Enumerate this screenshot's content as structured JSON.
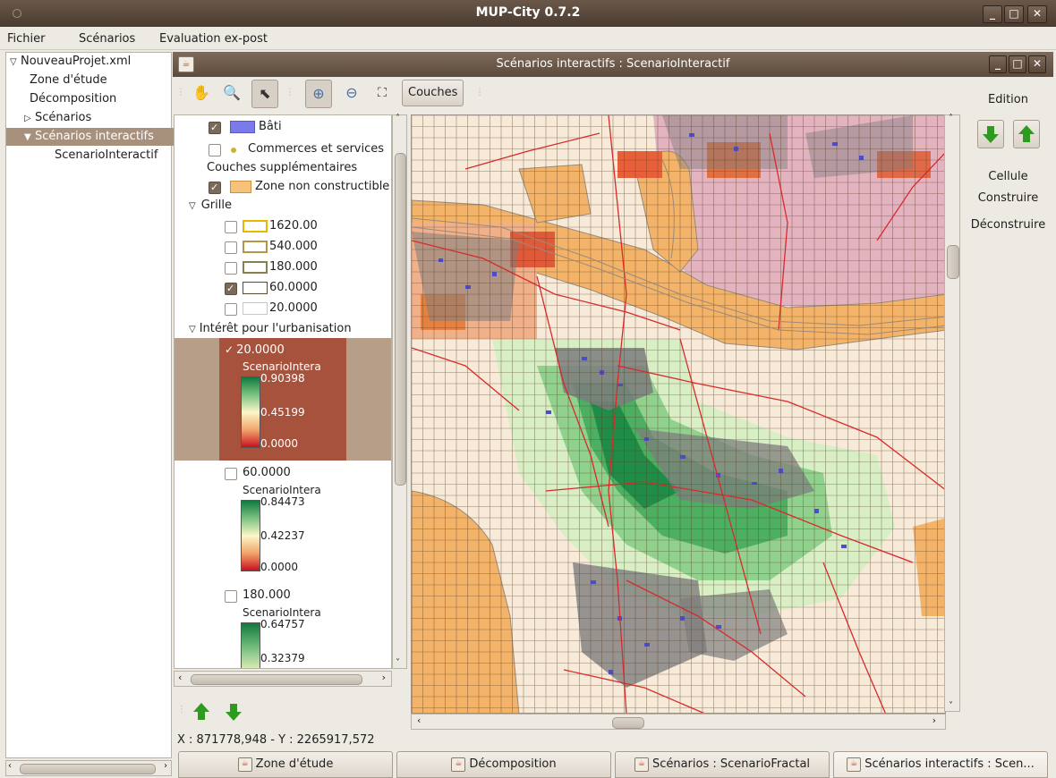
{
  "app": {
    "title": "MUP-City 0.7.2"
  },
  "menu": [
    "Fichier",
    "Scénarios",
    "Evaluation ex-post"
  ],
  "tree": [
    {
      "label": "NouveauProjet.xml",
      "arrow": "▽"
    },
    {
      "label": "Zone d'étude",
      "arrow": ""
    },
    {
      "label": "Décomposition",
      "arrow": ""
    },
    {
      "label": "Scénarios",
      "arrow": "▷"
    },
    {
      "label": "Scénarios interactifs",
      "arrow": "▼"
    },
    {
      "label": "ScenarioInteractif",
      "arrow": ""
    }
  ],
  "frame": {
    "title": "Scénarios interactifs : ScenarioInteractif"
  },
  "toolbar": {
    "couches_label": "Couches",
    "icons": [
      "pan-icon",
      "zoom-lens-icon",
      "pointer-icon",
      "zoom-in-icon",
      "zoom-out-icon",
      "full-extent-icon"
    ]
  },
  "legend": {
    "bati": "Bâti",
    "commerces": "Commerces et services",
    "couches_supp": "Couches supplémentaires",
    "zone_nc": "Zone non constructible",
    "grille": "Grille",
    "grid_sizes": [
      "1620.00",
      "540.000",
      "180.000",
      "60.0000",
      "20.0000"
    ],
    "grid_checked": [
      false,
      false,
      false,
      true,
      false
    ],
    "interet": "Intérêt pour l'urbanisation",
    "interet_layers": [
      {
        "name": "20.0000",
        "layer": "ScenarioIntera",
        "max": "0.90398",
        "mid": "0.45199",
        "min": "0.0000",
        "checked": true
      },
      {
        "name": "60.0000",
        "layer": "ScenarioIntera",
        "max": "0.84473",
        "mid": "0.42237",
        "min": "0.0000",
        "checked": false
      },
      {
        "name": "180.000",
        "layer": "ScenarioIntera",
        "max": "0.64757",
        "mid": "0.32379",
        "min": "",
        "checked": false
      }
    ],
    "colors": {
      "bati": "#7a7aec",
      "commerces": "#c9b52b",
      "zone_nc": "#f7c27a",
      "grid_outline": [
        "#e6b800",
        "#b4964a",
        "#8a7f4e",
        "#5b4a30",
        "#c8c8c8"
      ]
    }
  },
  "status": {
    "coords": "X : 871778,948 - Y : 2265917,572"
  },
  "edition": {
    "title": "Edition",
    "cellule": "Cellule",
    "construire": "Construire",
    "deconstruire": "Déconstruire"
  },
  "tabs": [
    {
      "label": "Zone d'étude",
      "active": false
    },
    {
      "label": "Décomposition",
      "active": false
    },
    {
      "label": "Scénarios : ScenarioFractal",
      "active": false
    },
    {
      "label": "Scénarios interactifs : Scen...",
      "active": true
    }
  ],
  "map_colors": {
    "non_buildable": "#f4b970",
    "pink_zone": "#e2b1bd",
    "grid": "#5b3d22",
    "roads": "#d82a2a",
    "buildings": "#4d4dcc",
    "built_cell": "#7d7d7d",
    "interest_high": "#1a8c45",
    "interest_low": "#d23b22"
  }
}
